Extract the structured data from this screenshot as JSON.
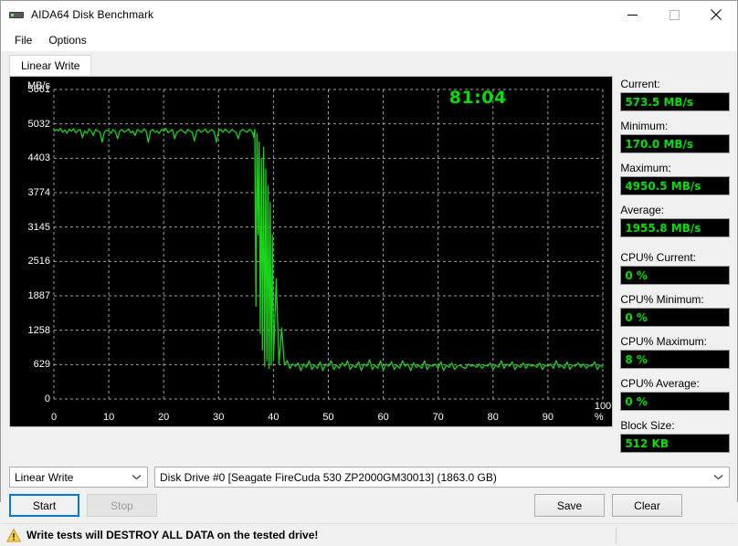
{
  "window": {
    "title": "AIDA64 Disk Benchmark",
    "icon": "disk-drive-icon",
    "buttons": {
      "minimize": "minimize-icon",
      "maximize": "maximize-icon",
      "close": "close-icon"
    }
  },
  "menu": {
    "items": [
      "File",
      "Options"
    ]
  },
  "tabs": [
    {
      "label": "Linear Write",
      "active": true
    }
  ],
  "chart_data": {
    "type": "line",
    "title": "",
    "timer": "81:04",
    "xlabel": "%",
    "ylabel": "MB/s",
    "ylim": [
      0,
      5661
    ],
    "xlim": [
      0,
      100
    ],
    "grid": true,
    "line_color": "#19d219",
    "background": "#000000",
    "gridline_color": "#a0a0a0",
    "ytick_labels": [
      "0",
      "629",
      "1258",
      "1887",
      "2516",
      "3145",
      "3774",
      "4403",
      "5032",
      "5661"
    ],
    "ytick_values": [
      0,
      629,
      1258,
      1887,
      2516,
      3145,
      3774,
      4403,
      5032,
      5661
    ],
    "xtick_labels": [
      "0",
      "10",
      "20",
      "30",
      "40",
      "50",
      "60",
      "70",
      "80",
      "90",
      "100 %"
    ],
    "xtick_values": [
      0,
      10,
      20,
      30,
      40,
      50,
      60,
      70,
      80,
      90,
      100
    ],
    "series": [
      {
        "name": "Linear Write",
        "x": [
          0,
          0.4,
          0.8,
          1.2,
          1.6,
          2,
          2.4,
          2.8,
          3.2,
          3.6,
          4,
          4.4,
          4.8,
          5.2,
          5.6,
          6,
          6.4,
          6.8,
          7.2,
          7.6,
          8,
          8.4,
          8.8,
          9.2,
          9.6,
          10,
          10.4,
          10.8,
          11.2,
          11.6,
          12,
          12.4,
          12.8,
          13.2,
          13.6,
          14,
          14.4,
          14.8,
          15.2,
          15.6,
          16,
          16.4,
          16.8,
          17.2,
          17.6,
          18,
          18.4,
          18.8,
          19.2,
          19.6,
          20,
          20.4,
          20.8,
          21.2,
          21.6,
          22,
          22.4,
          22.8,
          23.2,
          23.6,
          24,
          24.4,
          24.8,
          25.2,
          25.6,
          26,
          26.4,
          26.8,
          27.2,
          27.6,
          28,
          28.4,
          28.8,
          29.2,
          29.6,
          30,
          30.4,
          30.8,
          31.2,
          31.6,
          32,
          32.4,
          32.8,
          33.2,
          33.6,
          34,
          34.4,
          34.8,
          35.2,
          35.6,
          36,
          36.2,
          36.4,
          36.6,
          36.8,
          37,
          37.2,
          37.4,
          37.6,
          37.8,
          38,
          38.2,
          38.4,
          38.6,
          38.8,
          39,
          39.2,
          39.4,
          39.6,
          39.8,
          40,
          40.5,
          41,
          41.5,
          42,
          42.5,
          43,
          43.5,
          44,
          44.5,
          45,
          45.5,
          46,
          46.5,
          47,
          47.5,
          48,
          48.5,
          49,
          49.5,
          50,
          50.5,
          51,
          51.5,
          52,
          52.5,
          53,
          53.5,
          54,
          54.5,
          55,
          55.5,
          56,
          56.5,
          57,
          57.5,
          58,
          58.5,
          59,
          59.5,
          60,
          60.5,
          61,
          61.5,
          62,
          62.5,
          63,
          63.5,
          64,
          64.5,
          65,
          65.5,
          66,
          66.5,
          67,
          67.5,
          68,
          68.5,
          69,
          69.5,
          70,
          70.5,
          71,
          71.5,
          72,
          72.5,
          73,
          73.5,
          74,
          74.5,
          75,
          75.5,
          76,
          76.5,
          77,
          77.5,
          78,
          78.5,
          79,
          79.5,
          80,
          80.5,
          81,
          81.5,
          82,
          82.5,
          83,
          83.5,
          84,
          84.5,
          85,
          85.5,
          86,
          86.5,
          87,
          87.5,
          88,
          88.5,
          89,
          89.5,
          90,
          90.5,
          91,
          91.5,
          92,
          92.5,
          93,
          93.5,
          94,
          94.5,
          95,
          95.5,
          96,
          96.5,
          97,
          97.5,
          98,
          98.5,
          99,
          99.5,
          100
        ],
        "y": [
          4890,
          4930,
          4905,
          4950,
          4880,
          4920,
          4860,
          4935,
          4900,
          4945,
          4870,
          4910,
          4930,
          4780,
          4900,
          4860,
          4940,
          4895,
          4820,
          4930,
          4900,
          4880,
          4700,
          4880,
          4920,
          4900,
          4860,
          4930,
          4890,
          4760,
          4900,
          4930,
          4880,
          4900,
          4940,
          4870,
          4900,
          4820,
          4930,
          4900,
          4880,
          4940,
          4900,
          4690,
          4900,
          4930,
          4880,
          4900,
          4860,
          4930,
          4900,
          4950,
          4870,
          4900,
          4930,
          4760,
          4880,
          4900,
          4930,
          4890,
          4860,
          4930,
          4900,
          4880,
          4720,
          4900,
          4930,
          4880,
          4900,
          4940,
          4870,
          4900,
          4930,
          4880,
          4700,
          4900,
          4930,
          4880,
          4940,
          4900,
          4870,
          4930,
          4900,
          4880,
          4760,
          4900,
          4930,
          4900,
          4880,
          4930,
          4900,
          4870,
          4790,
          4930,
          1700,
          4850,
          3000,
          4700,
          1200,
          4400,
          900,
          4600,
          600,
          4200,
          700,
          3900,
          560,
          3600,
          620,
          3000,
          700,
          2200,
          640,
          1300,
          620,
          700,
          560,
          640,
          600,
          660,
          520,
          640,
          580,
          700,
          540,
          620,
          560,
          680,
          520,
          640,
          600,
          700,
          540,
          620,
          560,
          660,
          600,
          700,
          540,
          620,
          580,
          680,
          520,
          640,
          600,
          720,
          540,
          620,
          560,
          700,
          520,
          640,
          600,
          680,
          540,
          620,
          560,
          700,
          600,
          640,
          520,
          660,
          580,
          620,
          560,
          700,
          540,
          620,
          600,
          640,
          560,
          680,
          520,
          620,
          580,
          660,
          540,
          600,
          620,
          580,
          560,
          640,
          600,
          620,
          580,
          640,
          560,
          620,
          600,
          660,
          540,
          620,
          580,
          700,
          560,
          640,
          600,
          680,
          540,
          620,
          580,
          660,
          560,
          640,
          600,
          620,
          580,
          660,
          540,
          620,
          600,
          640,
          560,
          700,
          580,
          620,
          560,
          680,
          540,
          620,
          600,
          660,
          580,
          640,
          560,
          620,
          600,
          680,
          540,
          620,
          580,
          700,
          560,
          640,
          600,
          620,
          580,
          640,
          600,
          700,
          620,
          660,
          700,
          620,
          760,
          640,
          700,
          520,
          620,
          700,
          640,
          760,
          700,
          680,
          760,
          700,
          720,
          760,
          700,
          740
        ]
      }
    ]
  },
  "stats": [
    {
      "label": "Current:",
      "value": "573.5 MB/s",
      "gap_after": false
    },
    {
      "label": "Minimum:",
      "value": "170.0 MB/s",
      "gap_after": false
    },
    {
      "label": "Maximum:",
      "value": "4950.5 MB/s",
      "gap_after": false
    },
    {
      "label": "Average:",
      "value": "1955.8 MB/s",
      "gap_after": true
    },
    {
      "label": "CPU% Current:",
      "value": "0 %",
      "gap_after": false
    },
    {
      "label": "CPU% Minimum:",
      "value": "0 %",
      "gap_after": false
    },
    {
      "label": "CPU% Maximum:",
      "value": "8 %",
      "gap_after": false
    },
    {
      "label": "CPU% Average:",
      "value": "0 %",
      "gap_after": false
    },
    {
      "label": "Block Size:",
      "value": "512 KB",
      "gap_after": false
    }
  ],
  "controls": {
    "mode_combo": {
      "value": "Linear Write"
    },
    "drive_combo": {
      "value": "Disk Drive #0  [Seagate FireCuda 530 ZP2000GM30013]  (1863.0 GB)"
    },
    "start_button": "Start",
    "stop_button": "Stop",
    "save_button": "Save",
    "clear_button": "Clear"
  },
  "statusbar": {
    "warning": "Write tests will DESTROY ALL DATA on the tested drive!",
    "icon": "warning-triangle-icon"
  },
  "colors": {
    "accent_green": "#00e000",
    "line_green": "#19d219",
    "focus_blue": "#0078d7",
    "warning_yellow": "#f0c419"
  }
}
